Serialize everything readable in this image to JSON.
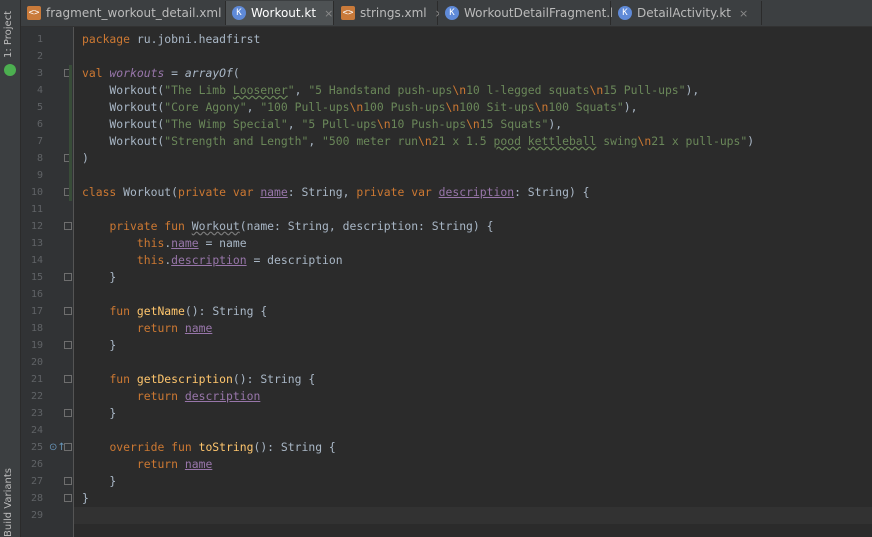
{
  "sidebar": {
    "project_label": "1: Project",
    "build_label": "Build Variants"
  },
  "tabs": [
    {
      "label": "fragment_workout_detail.xml",
      "type": "xml",
      "active": false
    },
    {
      "label": "Workout.kt",
      "type": "kt",
      "active": true
    },
    {
      "label": "strings.xml",
      "type": "xml",
      "active": false
    },
    {
      "label": "WorkoutDetailFragment.kt",
      "type": "kt",
      "active": false
    },
    {
      "label": "DetailActivity.kt",
      "type": "kt",
      "active": false
    }
  ],
  "close_glyph": "×",
  "colors": {
    "background": "#2b2b2b",
    "keyword": "#cc7832",
    "string": "#6a8759",
    "function": "#ffc66d",
    "property": "#9876aa",
    "text": "#a9b7c6"
  },
  "code_lines": [
    [
      {
        "t": "package ",
        "c": "kw"
      },
      {
        "t": "ru.jobni.headfirst"
      }
    ],
    [],
    [
      {
        "t": "val ",
        "c": "kw"
      },
      {
        "t": "workouts",
        "c": "prop ital"
      },
      {
        "t": " = "
      },
      {
        "t": "arrayOf",
        "c": "ital"
      },
      {
        "t": "("
      }
    ],
    [
      {
        "t": "    Workout("
      },
      {
        "t": "\"The Limb ",
        "c": "str"
      },
      {
        "t": "Loosener",
        "c": "str typo"
      },
      {
        "t": "\"",
        "c": "str"
      },
      {
        "t": ", "
      },
      {
        "t": "\"5 Handstand push-ups",
        "c": "str"
      },
      {
        "t": "\\n",
        "c": "esc"
      },
      {
        "t": "10 l-legged squats",
        "c": "str"
      },
      {
        "t": "\\n",
        "c": "esc"
      },
      {
        "t": "15 Pull-ups\"",
        "c": "str"
      },
      {
        "t": "),"
      }
    ],
    [
      {
        "t": "    Workout("
      },
      {
        "t": "\"Core Agony\"",
        "c": "str"
      },
      {
        "t": ", "
      },
      {
        "t": "\"100 Pull-ups",
        "c": "str"
      },
      {
        "t": "\\n",
        "c": "esc"
      },
      {
        "t": "100 Push-ups",
        "c": "str"
      },
      {
        "t": "\\n",
        "c": "esc"
      },
      {
        "t": "100 Sit-ups",
        "c": "str"
      },
      {
        "t": "\\n",
        "c": "esc"
      },
      {
        "t": "100 Squats\"",
        "c": "str"
      },
      {
        "t": "),"
      }
    ],
    [
      {
        "t": "    Workout("
      },
      {
        "t": "\"The Wimp Special\"",
        "c": "str"
      },
      {
        "t": ", "
      },
      {
        "t": "\"5 Pull-ups",
        "c": "str"
      },
      {
        "t": "\\n",
        "c": "esc"
      },
      {
        "t": "10 Push-ups",
        "c": "str"
      },
      {
        "t": "\\n",
        "c": "esc"
      },
      {
        "t": "15 Squats\"",
        "c": "str"
      },
      {
        "t": "),"
      }
    ],
    [
      {
        "t": "    Workout("
      },
      {
        "t": "\"Strength and Length\"",
        "c": "str"
      },
      {
        "t": ", "
      },
      {
        "t": "\"500 meter run",
        "c": "str"
      },
      {
        "t": "\\n",
        "c": "esc"
      },
      {
        "t": "21 x 1.5 ",
        "c": "str"
      },
      {
        "t": "pood",
        "c": "str typo"
      },
      {
        "t": " ",
        "c": "str"
      },
      {
        "t": "kettleball",
        "c": "str typo"
      },
      {
        "t": " swing",
        "c": "str"
      },
      {
        "t": "\\n",
        "c": "esc"
      },
      {
        "t": "21 x pull-ups\"",
        "c": "str"
      },
      {
        "t": ")"
      }
    ],
    [
      {
        "t": ")"
      }
    ],
    [],
    [
      {
        "t": "class ",
        "c": "kw"
      },
      {
        "t": "Workout("
      },
      {
        "t": "private var ",
        "c": "kw"
      },
      {
        "t": "name",
        "c": "prop-ul"
      },
      {
        "t": ": String, "
      },
      {
        "t": "private var ",
        "c": "kw"
      },
      {
        "t": "description",
        "c": "prop-ul"
      },
      {
        "t": ": String) {"
      }
    ],
    [],
    [
      {
        "t": "    "
      },
      {
        "t": "private fun ",
        "c": "kw"
      },
      {
        "t": "Workout",
        "c": "typo2"
      },
      {
        "t": "(name: String, description: String) {"
      }
    ],
    [
      {
        "t": "        "
      },
      {
        "t": "this",
        "c": "kw"
      },
      {
        "t": "."
      },
      {
        "t": "name",
        "c": "prop-ul"
      },
      {
        "t": " = name"
      }
    ],
    [
      {
        "t": "        "
      },
      {
        "t": "this",
        "c": "kw"
      },
      {
        "t": "."
      },
      {
        "t": "description",
        "c": "prop-ul"
      },
      {
        "t": " = description"
      }
    ],
    [
      {
        "t": "    }"
      }
    ],
    [],
    [
      {
        "t": "    "
      },
      {
        "t": "fun ",
        "c": "kw"
      },
      {
        "t": "getName",
        "c": "fn"
      },
      {
        "t": "(): String {"
      }
    ],
    [
      {
        "t": "        "
      },
      {
        "t": "return ",
        "c": "kw"
      },
      {
        "t": "name",
        "c": "prop-ul"
      }
    ],
    [
      {
        "t": "    }"
      }
    ],
    [],
    [
      {
        "t": "    "
      },
      {
        "t": "fun ",
        "c": "kw"
      },
      {
        "t": "getDescription",
        "c": "fn"
      },
      {
        "t": "(): String {"
      }
    ],
    [
      {
        "t": "        "
      },
      {
        "t": "return ",
        "c": "kw"
      },
      {
        "t": "description",
        "c": "prop-ul"
      }
    ],
    [
      {
        "t": "    }"
      }
    ],
    [],
    [
      {
        "t": "    "
      },
      {
        "t": "override fun ",
        "c": "kw"
      },
      {
        "t": "toString",
        "c": "fn"
      },
      {
        "t": "(): String {"
      }
    ],
    [
      {
        "t": "        "
      },
      {
        "t": "return ",
        "c": "kw"
      },
      {
        "t": "name",
        "c": "prop-ul"
      }
    ],
    [
      {
        "t": "    }"
      }
    ],
    [
      {
        "t": "}"
      }
    ],
    []
  ],
  "fold_markers": [
    3,
    8,
    10,
    12,
    15,
    17,
    19,
    21,
    23,
    25,
    27,
    28
  ],
  "override_line": 25,
  "current_line": 29
}
